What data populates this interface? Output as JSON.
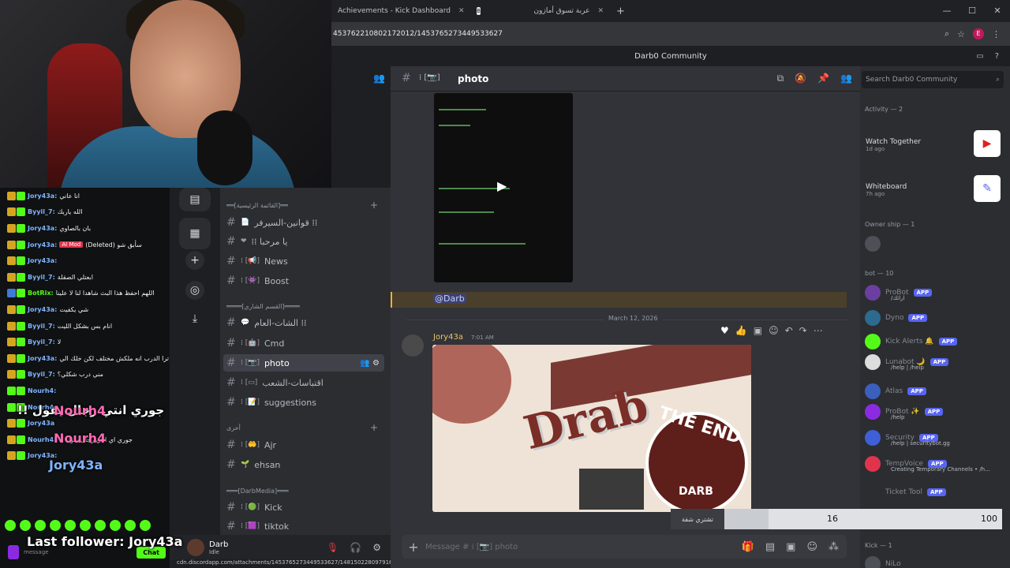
{
  "browser": {
    "tabs": [
      {
        "label": "Achievements - Kick Dashboard"
      },
      {
        "label": "عربة تسوق أمازون"
      }
    ],
    "url": "453762210802172012/1453765273449533627",
    "new_tab": "+"
  },
  "discord": {
    "server_name": "Darb0 Community",
    "channel_name": "photo",
    "search_placeholder": "Search Darb0 Community",
    "composer_placeholder": "Message # ⁞ [📷] photo"
  },
  "channels": {
    "categories": [
      {
        "label": "══[القائمة الرئيسية]══"
      },
      {
        "label": "════[القسم الشاري]════"
      },
      {
        "label": "أخرى"
      },
      {
        "label": "═══[DarbMedia]═══"
      }
    ],
    "items": [
      {
        "label": "قوانين-السيرفر ⁞⁞"
      },
      {
        "label": "⁞⁞ يا مرحبا"
      },
      {
        "label": "News"
      },
      {
        "label": "Boost"
      },
      {
        "label": "الشات-العام ⁞⁞"
      },
      {
        "label": "Cmd"
      },
      {
        "label": "photo"
      },
      {
        "label": "اقتباسات-الشعب"
      },
      {
        "label": "suggestions"
      },
      {
        "label": "Ajr"
      },
      {
        "label": "ehsan"
      },
      {
        "label": "Kick"
      },
      {
        "label": "tiktok"
      }
    ]
  },
  "messages": {
    "mention": "@Darb",
    "date_divider": "March 12, 2026",
    "author": "Jory43a",
    "time": "7:01 AM",
    "image_text": {
      "title": "Drab",
      "subtitle": "THE END",
      "logo": "DARB"
    }
  },
  "user_panel": {
    "name": "Darb",
    "status": "Idle"
  },
  "status_url": "cdn.discordapp.com/attachments/1453765273449533627/1481502280979165026/IMG_6882.png?...",
  "right_sidebar": {
    "activity_title": "Activity — 2",
    "activities": [
      {
        "name": "Watch Together",
        "time": "1d ago"
      },
      {
        "name": "Whiteboard",
        "time": "7h ago"
      }
    ],
    "owner_title": "Owner ship — 1",
    "bot_title": "bot — 10",
    "bots": [
      {
        "name": "ProBot",
        "sub": "/ارائك"
      },
      {
        "name": "Dyno",
        "sub": ""
      },
      {
        "name": "Kick Alerts 🔔",
        "sub": ""
      },
      {
        "name": "Lunabot 🌙",
        "sub": "/help | /help"
      },
      {
        "name": "Atlas",
        "sub": ""
      },
      {
        "name": "ProBot ✨",
        "sub": "/help"
      },
      {
        "name": "Security",
        "sub": "/help | securitybot.gg"
      },
      {
        "name": "TempVoice",
        "sub": "Creating Temporary Channels • /h..."
      },
      {
        "name": "Ticket Tool",
        "sub": ""
      }
    ],
    "app_tag": "APP",
    "kick_title": "Kick — 1",
    "kick_member": "NiLo"
  },
  "progress": {
    "label": "تشتري شقة",
    "current": "16",
    "max": "100",
    "fraction": 0.16
  },
  "chat_overlay": {
    "lines": [
      {
        "name": "Jory43a:",
        "msg": "انا عاني",
        "badge": "gold"
      },
      {
        "name": "Byyil_7:",
        "msg": "الله ياربك",
        "badge": "gold"
      },
      {
        "name": "Jory43a:",
        "msg": "بان بالصاوي",
        "badge": "gold"
      },
      {
        "name": "Jory43a:",
        "msg": "(Deleted) سأبق شو",
        "badge": "gold",
        "mod": "AI Mod"
      },
      {
        "name": "Jory43a:",
        "msg": "",
        "badge": "gold"
      },
      {
        "name": "Byyil_7:",
        "msg": "ابعتلي الصقلة",
        "badge": "gold"
      },
      {
        "name": "BotRix:",
        "msg": "اللهم احفظ هذا البث شاهدا لنا لا علينا",
        "badge": "blue"
      },
      {
        "name": "Jory43a:",
        "msg": "شي يكفيت",
        "badge": "gold"
      },
      {
        "name": "Byyil_7:",
        "msg": "انام بس بشكل الليت",
        "badge": "gold"
      },
      {
        "name": "Byyil_7:",
        "msg": "لا",
        "badge": "gold"
      },
      {
        "name": "Jory43a:",
        "msg": "ترا الدرب انه ملكش مختلف لكن خلك الي",
        "badge": "gold"
      },
      {
        "name": "Byyil_7:",
        "msg": "مني درب شكلي؟",
        "badge": "gold"
      },
      {
        "name": "Nourh4:",
        "msg": "",
        "badge": "green"
      },
      {
        "name": "Nourh4",
        "msg": "",
        "badge": "green"
      },
      {
        "name": "Jory43a",
        "msg": "",
        "badge": "gold"
      },
      {
        "name": "Nourh4:",
        "msg": "!! جوري اي انتي رجال يقول",
        "badge": "gold"
      },
      {
        "name": "Jory43a:",
        "msg": "",
        "badge": "gold"
      }
    ],
    "big_message": "!! جوري انتي رجال يقول",
    "big_name_1": "Nourh4",
    "big_name_2": "Nourh4",
    "big_name_3": "Jory43a",
    "last_follower": "Last follower: Jory43a",
    "input_placeholder": "message",
    "chat_button": "Chat"
  }
}
